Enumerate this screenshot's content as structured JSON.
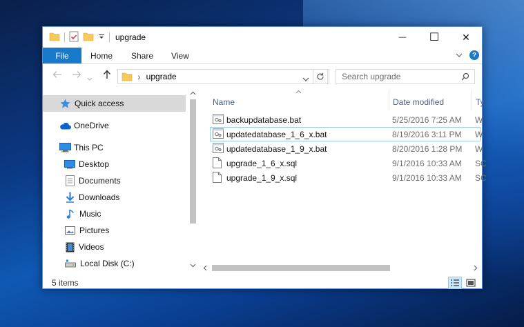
{
  "window": {
    "title": "upgrade",
    "controls": {
      "minimize": "—",
      "maximize": "☐",
      "close": "✕"
    }
  },
  "ribbon": {
    "tabs": [
      "File",
      "Home",
      "Share",
      "View"
    ],
    "help": "?"
  },
  "address": {
    "separator": "›",
    "folder": "upgrade",
    "search_placeholder": "Search upgrade"
  },
  "nav_pane": {
    "items": [
      {
        "label": "Quick access",
        "icon": "star-icon",
        "selected": true
      },
      {
        "label": "OneDrive",
        "icon": "cloud-icon"
      },
      {
        "label": "This PC",
        "icon": "computer-icon"
      },
      {
        "label": "Desktop",
        "icon": "desktop-icon"
      },
      {
        "label": "Documents",
        "icon": "documents-icon"
      },
      {
        "label": "Downloads",
        "icon": "downloads-icon"
      },
      {
        "label": "Music",
        "icon": "music-icon"
      },
      {
        "label": "Pictures",
        "icon": "pictures-icon"
      },
      {
        "label": "Videos",
        "icon": "videos-icon"
      },
      {
        "label": "Local Disk (C:)",
        "icon": "drive-icon"
      }
    ]
  },
  "file_list": {
    "columns": {
      "name": "Name",
      "date": "Date modified",
      "type": "Ty"
    },
    "rows": [
      {
        "name": "backupdatabase.bat",
        "date": "5/25/2016 7:25 AM",
        "type": "W",
        "icon": "batch-file-icon"
      },
      {
        "name": "updatedatabase_1_6_x.bat",
        "date": "8/19/2016 3:11 PM",
        "type": "W",
        "icon": "batch-file-icon",
        "focused": true
      },
      {
        "name": "updatedatabase_1_9_x.bat",
        "date": "8/20/2016 1:28 PM",
        "type": "W",
        "icon": "batch-file-icon"
      },
      {
        "name": "upgrade_1_6_x.sql",
        "date": "9/1/2016 10:33 AM",
        "type": "SC",
        "icon": "sql-file-icon"
      },
      {
        "name": "upgrade_1_9_x.sql",
        "date": "9/1/2016 10:33 AM",
        "type": "SC",
        "icon": "sql-file-icon"
      }
    ]
  },
  "status": {
    "item_count": "5 items"
  },
  "colors": {
    "accent": "#1979ca",
    "folder": "#f6c95c",
    "selection": "#d9d9d9",
    "focus": "#99c9ef"
  }
}
